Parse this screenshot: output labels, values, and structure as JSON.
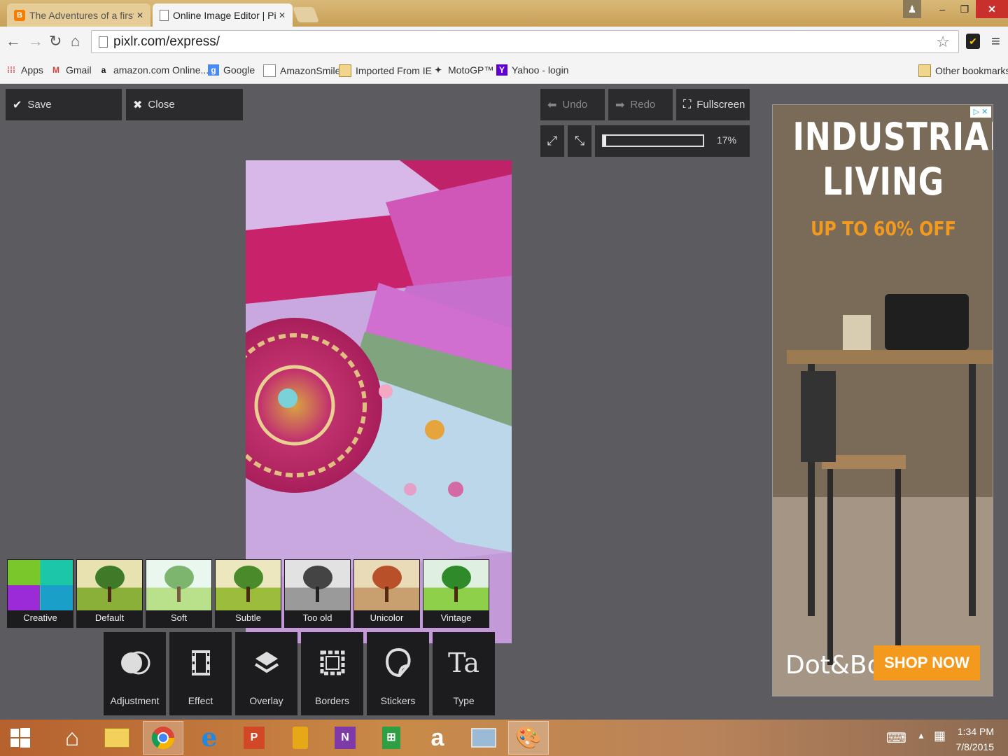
{
  "browser": {
    "tabs": [
      {
        "title": "The Adventures of a first t",
        "favicon": "blogger-icon",
        "active": false
      },
      {
        "title": "Online Image Editor | Pixlr",
        "favicon": "page-icon",
        "active": true
      }
    ],
    "address": "pixlr.com/express/",
    "bookmarks": [
      {
        "label": "Apps",
        "icon": "apps-grid-icon"
      },
      {
        "label": "Gmail",
        "icon": "gmail-icon"
      },
      {
        "label": "amazon.com Online...",
        "icon": "amazon-icon"
      },
      {
        "label": "Google",
        "icon": "google-icon"
      },
      {
        "label": "AmazonSmile",
        "icon": "page-icon"
      },
      {
        "label": "Imported From IE",
        "icon": "folder-icon"
      },
      {
        "label": "MotoGP™",
        "icon": "motogp-icon"
      },
      {
        "label": "Yahoo - login",
        "icon": "yahoo-icon"
      }
    ],
    "other_bookmarks": "Other bookmarks"
  },
  "editor": {
    "save_label": "Save",
    "close_label": "Close",
    "undo_label": "Undo",
    "redo_label": "Redo",
    "fullscreen_label": "Fullscreen",
    "zoom_label": "17%",
    "zoom_fraction": 0.03,
    "effects": [
      "Creative",
      "Default",
      "Soft",
      "Subtle",
      "Too old",
      "Unicolor",
      "Vintage"
    ],
    "categories": [
      "Adjustment",
      "Effect",
      "Overlay",
      "Borders",
      "Stickers",
      "Type"
    ]
  },
  "ad": {
    "headline_line1": "INDUSTRIAL",
    "headline_line2": "LIVING",
    "offer": "UP TO 60% OFF",
    "brand": "Dot&Bo",
    "cta": "SHOP NOW"
  },
  "taskbar": {
    "time": "1:34 PM",
    "date": "7/8/2015"
  },
  "colors": {
    "accent_orange": "#f39a1e",
    "editor_bg": "#5c5b60",
    "panel_dark": "#2b2b2d"
  }
}
